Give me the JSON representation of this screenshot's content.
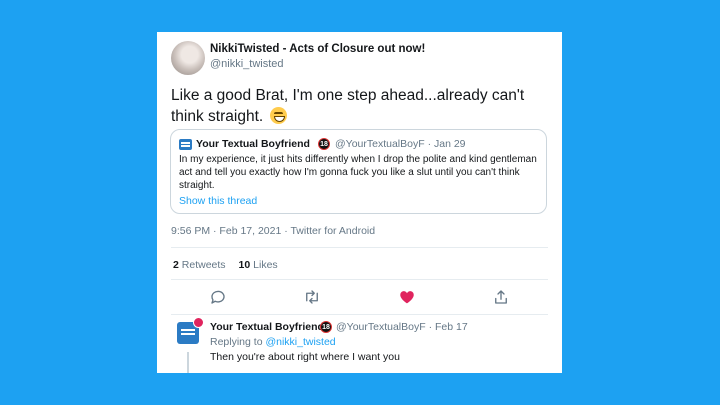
{
  "tweet": {
    "author_name": "NikkiTwisted - Acts of Closure out now!",
    "author_handle": "@nikki_twisted",
    "text": "Like a good Brat, I'm one step ahead...already can't think straight.",
    "emoji_icon": "grinning-face-emoji",
    "timestamp": "9:56 PM · Feb 17, 2021 · Twitter for Android",
    "retweets_count": "2",
    "retweets_label": "Retweets",
    "likes_count": "10",
    "likes_label": "Likes",
    "liked": true,
    "like_color": "#e0245e"
  },
  "quoted_tweet": {
    "author_name": "Your Textual Boyfriend",
    "badge": "18",
    "meta": "@YourTextualBoyF · Jan 29",
    "text": "In my experience, it just hits differently when I drop the polite and kind gentleman act and tell you exactly how I'm gonna fuck you like a slut until you can't think straight.",
    "show_thread": "Show this thread"
  },
  "actions": [
    {
      "name": "reply",
      "icon": "comment-icon"
    },
    {
      "name": "retweet",
      "icon": "retweet-icon"
    },
    {
      "name": "like",
      "icon": "heart-icon"
    },
    {
      "name": "share",
      "icon": "share-icon"
    }
  ],
  "reply": {
    "author_name": "Your Textual Boyfriend",
    "badge": "18",
    "meta": "@YourTextualBoyF · Feb 17",
    "replying_prefix": "Replying to",
    "replying_handle": "@nikki_twisted",
    "text": "Then you're about right where I want you"
  },
  "colors": {
    "background": "#1da1f2",
    "accent": "#1da1f2",
    "secondary_text": "#657786"
  }
}
